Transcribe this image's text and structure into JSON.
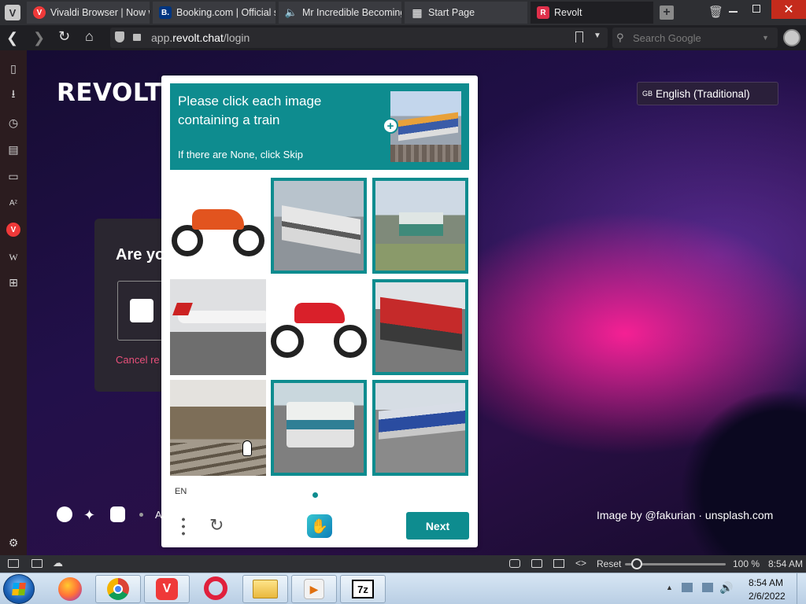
{
  "browser": {
    "tabs": [
      {
        "label": "Vivaldi Browser | Now w",
        "icon": "vivaldi-icon",
        "color": "#ef3939"
      },
      {
        "label": "Booking.com | Official s",
        "icon": "booking-icon",
        "color": "#003580",
        "glyph": "B."
      },
      {
        "label": "Mr Incredible Becoming",
        "icon": "speaker-icon",
        "color": "#3a3b40"
      },
      {
        "label": "Start Page",
        "icon": "grid-icon",
        "color": "#3a3b40"
      },
      {
        "label": "Revolt",
        "icon": "revolt-icon",
        "color": "#e0304b",
        "glyph": "R"
      }
    ],
    "url_prefix": "app.",
    "url_domain": "revolt.chat",
    "url_path": "/login",
    "search_placeholder": "Search Google"
  },
  "page": {
    "logo": "REVOLT",
    "heading_fragment": "Are yo",
    "cancel_fragment": "Cancel re",
    "language": "English (Traditional)",
    "language_flag": "GB",
    "credit": "Image by @fakurian · unsplash.com",
    "footer_fragment": "A"
  },
  "captcha": {
    "instruction_line1": "Please click each image",
    "instruction_line2": "containing a train",
    "skip_hint": "If there are None, click Skip",
    "language_code": "EN",
    "next_label": "Next",
    "accent": "#0e8c8f",
    "tiles": [
      {
        "subject": "motorbike",
        "selected": false
      },
      {
        "subject": "train",
        "selected": true
      },
      {
        "subject": "train",
        "selected": true
      },
      {
        "subject": "airplane",
        "selected": false
      },
      {
        "subject": "motorbike",
        "selected": false
      },
      {
        "subject": "train",
        "selected": true
      },
      {
        "subject": "train",
        "selected": false
      },
      {
        "subject": "train",
        "selected": true
      },
      {
        "subject": "train",
        "selected": true
      }
    ]
  },
  "statusbar": {
    "reset_label": "Reset",
    "zoom": "100 %",
    "time": "8:54 AM",
    "zoom_level_pct": 12
  },
  "taskbar": {
    "time": "8:54 AM",
    "date": "2/6/2022"
  }
}
